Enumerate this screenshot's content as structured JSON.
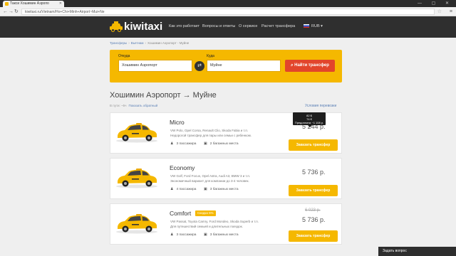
{
  "browser": {
    "tab_title": "Такси Хошимин Аэропо",
    "url": "kiwitaxi.ru/Vietnam/Ho+Chi+Minh+Airport~Mui+Ne",
    "window_controls": "— ▢ ✕"
  },
  "header": {
    "logo": "kiwitaxi",
    "nav": [
      "Как это работает",
      "Вопросы и ответы",
      "О сервисе",
      "Расчет трансфера"
    ],
    "currency": "RUB ▾"
  },
  "breadcrumb": [
    "Трансферы",
    "Вьетнам",
    "Хошимин Аэропорт - Муйне"
  ],
  "search": {
    "from_label": "Откуда",
    "from_value": "Хошимин Аэропорт",
    "to_label": "Куда",
    "to_value": "Муйне",
    "button": "Найти трансфер"
  },
  "route": {
    "title": "Хошимин Аэропорт → Муйне",
    "subtitle": "В пути: ~5ч",
    "reverse_link": "Показать обратный",
    "conditions_link": "Условия перевозки"
  },
  "tooltip": {
    "line1": "82 $",
    "line2": "74 €",
    "line3": "Предоплата ~1 108 р."
  },
  "cards": [
    {
      "name": "Micro",
      "badge": "",
      "models": "VW Polo, Opel Corsa, Renault Clio, Skoda Fabia и т.п.",
      "desc": "Недорогой трансфер для пары или семьи с ребенком.",
      "passengers": "3 пассажира",
      "luggage": "2 багажных места",
      "old_price": "",
      "price": "5 244 р.",
      "button": "Заказать трансфер",
      "color": "#f5b800"
    },
    {
      "name": "Economy",
      "badge": "",
      "models": "VW Golf, Ford Focus, Opel Astra, Audi A3, BMW 3 и т.п.",
      "desc": "Экономичный вариант для компании до 3-4 человек.",
      "passengers": "4 пассажира",
      "luggage": "3 багажных места",
      "old_price": "",
      "price": "5 736 р.",
      "button": "Заказать трансфер",
      "color": "#f5b800"
    },
    {
      "name": "Comfort",
      "badge": "Скидка 5%",
      "models": "VW Passat, Toyota Camry, Ford Mondeo, Skoda Superb и т.п.",
      "desc": "Для путешествий семьей и длительных поездок.",
      "passengers": "3 пассажира",
      "luggage": "3 багажных места",
      "old_price": "6 023 р.",
      "price": "5 736 р.",
      "button": "Заказать трансфер",
      "color": "#f5b800"
    }
  ],
  "chat": "Задать вопрос",
  "icons": {
    "passengers": "user-icon",
    "luggage": "suitcase-icon",
    "swap": "swap-icon",
    "search": "search-icon"
  },
  "colors": {
    "brand_yellow": "#f5b800",
    "header_dark": "#2f2f2f",
    "search_red": "#e2452b"
  }
}
